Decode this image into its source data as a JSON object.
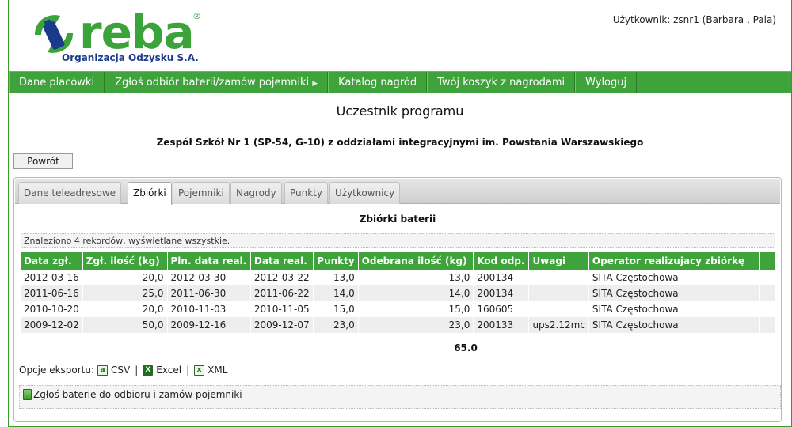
{
  "header": {
    "logo_word": "reba",
    "logo_reg": "®",
    "logo_sub": "Organizacja Odzysku S.A.",
    "user_label": "Użytkownik: zsnr1 (Barbara , Pala)"
  },
  "menu": [
    {
      "label": "Dane placówki",
      "arrow": ""
    },
    {
      "label": "Zgłoś odbiór baterii/zamów pojemniki",
      "arrow": "▶"
    },
    {
      "label": "Katalog nagród",
      "arrow": ""
    },
    {
      "label": "Twój koszyk z nagrodami",
      "arrow": ""
    },
    {
      "label": "Wyloguj",
      "arrow": ""
    }
  ],
  "page_title": "Uczestnik programu",
  "school_name": "Zespół Szkół Nr 1 (SP-54, G-10) z oddziałami integracyjnymi im. Powstania Warszawskiego",
  "back_button": "Powrót",
  "tabs": [
    {
      "label": "Dane teleadresowe",
      "active": false
    },
    {
      "label": "Zbiórki",
      "active": true
    },
    {
      "label": "Pojemniki",
      "active": false
    },
    {
      "label": "Nagrody",
      "active": false
    },
    {
      "label": "Punkty",
      "active": false
    },
    {
      "label": "Użytkownicy",
      "active": false
    }
  ],
  "section_title": "Zbiórki baterii",
  "found_text": "Znaleziono 4 rekordów, wyświetlane wszystkie.",
  "table": {
    "columns": [
      "Data zgł.",
      "Zgł. ilość (kg)",
      "Pln. data real.",
      "Data real.",
      "Punkty",
      "Odebrana ilość (kg)",
      "Kod odp.",
      "Uwagi",
      "Operator realizujacy zbiórkę"
    ],
    "rows": [
      [
        "2012-03-16",
        "20,0",
        "2012-03-30",
        "2012-03-22",
        "13,0",
        "13,0",
        "200134",
        "",
        "SITA Częstochowa"
      ],
      [
        "2011-06-16",
        "25,0",
        "2011-06-30",
        "2011-06-22",
        "14,0",
        "14,0",
        "200134",
        "",
        "SITA Częstochowa"
      ],
      [
        "2010-10-20",
        "20,0",
        "2010-11-03",
        "2010-11-05",
        "15,0",
        "15,0",
        "160605",
        "",
        "SITA Częstochowa"
      ],
      [
        "2009-12-02",
        "50,0",
        "2009-12-16",
        "2009-12-07",
        "23,0",
        "23,0",
        "200133",
        "ups2.12mc",
        "SITA Częstochowa"
      ]
    ],
    "total": "65.0"
  },
  "export": {
    "label": "Opcje eksportu:",
    "options": [
      "CSV",
      "Excel",
      "XML"
    ]
  },
  "report_link": "Zgłoś baterie do odbioru i zamów pojemniki",
  "colors": {
    "brand_green": "#3ea33a",
    "brand_blue": "#1c3a8c"
  }
}
